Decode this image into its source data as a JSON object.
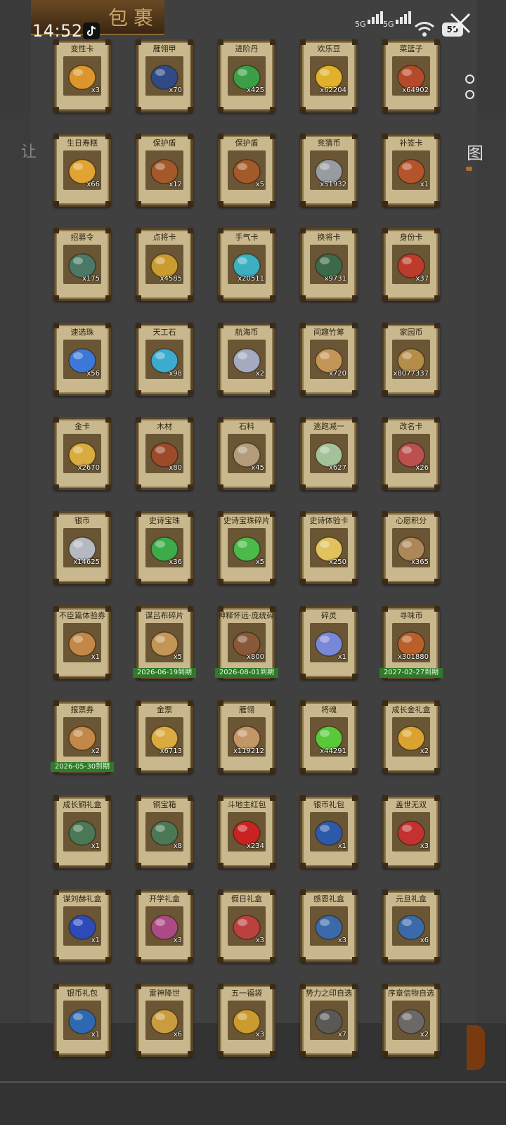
{
  "status_bar": {
    "time": "14:52",
    "net1": "5G",
    "net2": "5G",
    "battery": "55"
  },
  "header": {
    "title": "包裹"
  },
  "side": {
    "left_glyph": "让",
    "right_glyph": "图"
  },
  "items": [
    {
      "name": "变性卡",
      "count": "x3",
      "icon": "gender-card-icon",
      "color": "#e39a2c"
    },
    {
      "name": "雁翎甲",
      "count": "x70",
      "icon": "armor-icon",
      "color": "#2c4a8a"
    },
    {
      "name": "进阶丹",
      "count": "x425",
      "icon": "pill-icon",
      "color": "#3aa34a"
    },
    {
      "name": "欢乐豆",
      "count": "x62204",
      "icon": "beans-icon",
      "color": "#e8b62c"
    },
    {
      "name": "菜篮子",
      "count": "x64902",
      "icon": "basket-icon",
      "color": "#b84a2a"
    },
    {
      "name": "生日寿糕",
      "count": "x66",
      "icon": "cake-icon",
      "color": "#e8a832"
    },
    {
      "name": "保护盾",
      "count": "x12",
      "icon": "shield-icon",
      "color": "#a85a2a"
    },
    {
      "name": "保护盾",
      "count": "x5",
      "icon": "shield-icon",
      "color": "#a85a2a"
    },
    {
      "name": "竞猜币",
      "count": "x51932",
      "icon": "coin-icon",
      "color": "#9aa0a8"
    },
    {
      "name": "补签卡",
      "count": "x1",
      "icon": "sign-card-icon",
      "color": "#b8542a"
    },
    {
      "name": "招募令",
      "count": "x175",
      "icon": "recruit-icon",
      "color": "#4a7a6a"
    },
    {
      "name": "点将卡",
      "count": "x4585",
      "icon": "general-card-icon",
      "color": "#d0a030"
    },
    {
      "name": "手气卡",
      "count": "x20511",
      "icon": "luck-card-icon",
      "color": "#3ab4c8"
    },
    {
      "name": "换将卡",
      "count": "x9731",
      "icon": "swap-card-icon",
      "color": "#3a6a4a"
    },
    {
      "name": "身份卡",
      "count": "x37",
      "icon": "identity-card-icon",
      "color": "#c23a2a"
    },
    {
      "name": "速选珠",
      "count": "x56",
      "icon": "orb-icon",
      "color": "#3a7ae0"
    },
    {
      "name": "天工石",
      "count": "x98",
      "icon": "crystal-icon",
      "color": "#3ab0d8"
    },
    {
      "name": "航海币",
      "count": "x2",
      "icon": "coin-icon",
      "color": "#a8b0c8"
    },
    {
      "name": "间趣竹筹",
      "count": "x720",
      "icon": "bamboo-icon",
      "color": "#c89a5a"
    },
    {
      "name": "家园币",
      "count": "x8077337",
      "icon": "coin-icon",
      "color": "#b8904a"
    },
    {
      "name": "金卡",
      "count": "x2670",
      "icon": "gold-card-icon",
      "color": "#e0b040"
    },
    {
      "name": "木材",
      "count": "x80",
      "icon": "wood-icon",
      "color": "#a04a2a"
    },
    {
      "name": "石料",
      "count": "x45",
      "icon": "stone-icon",
      "color": "#b8a080"
    },
    {
      "name": "逃跑减一",
      "count": "x627",
      "icon": "tag-icon",
      "color": "#a8c8a0"
    },
    {
      "name": "改名卡",
      "count": "x26",
      "icon": "rename-card-icon",
      "color": "#c05050"
    },
    {
      "name": "银币",
      "count": "x14625",
      "icon": "silver-coins-icon",
      "color": "#b8c0c8"
    },
    {
      "name": "史诗宝珠",
      "count": "x36",
      "icon": "orb-icon",
      "color": "#3ab04a"
    },
    {
      "name": "史诗宝珠碎片",
      "count": "x5",
      "icon": "leaf-icon",
      "color": "#4ac04a"
    },
    {
      "name": "史诗体验卡",
      "count": "x250",
      "icon": "epic-card-icon",
      "color": "#e8c860"
    },
    {
      "name": "心愿积分",
      "count": "x365",
      "icon": "heart-coin-icon",
      "color": "#b08a5a"
    },
    {
      "name": "不臣篇体验券",
      "count": "x1",
      "icon": "ticket-icon",
      "color": "#c88a4a"
    },
    {
      "name": "谋吕布碎片",
      "count": "x5",
      "icon": "fragment-icon",
      "color": "#c89a5a",
      "expiry": "2026-06-19到期"
    },
    {
      "name": "神释怀远·庞统碎片",
      "count": "x800",
      "icon": "portrait-icon",
      "color": "#8a5a3a",
      "expiry": "2026-08-01到期"
    },
    {
      "name": "碎灵",
      "count": "x1",
      "icon": "crystal-icon",
      "color": "#7a8ae0"
    },
    {
      "name": "寻味币",
      "count": "x301880",
      "icon": "coin-icon",
      "color": "#c0602a",
      "expiry": "2027-02-27到期"
    },
    {
      "name": "报票券",
      "count": "x2",
      "icon": "ticket-icon",
      "color": "#c88a4a",
      "expiry": "2026-05-30到期"
    },
    {
      "name": "金票",
      "count": "x6713",
      "icon": "scroll-icon",
      "color": "#e0b040"
    },
    {
      "name": "雁翎",
      "count": "x119212",
      "icon": "feather-icon",
      "color": "#c89a6a"
    },
    {
      "name": "将魂",
      "count": "x44291",
      "icon": "soul-icon",
      "color": "#5ad03a"
    },
    {
      "name": "成长金礼盒",
      "count": "x2",
      "icon": "gold-chest-icon",
      "color": "#e0a830"
    },
    {
      "name": "成长铜礼盒",
      "count": "x1",
      "icon": "chest-icon",
      "color": "#4a7a5a"
    },
    {
      "name": "铜宝箱",
      "count": "x8",
      "icon": "chest-icon",
      "color": "#4a7a5a"
    },
    {
      "name": "斗地主红包",
      "count": "x234",
      "icon": "red-packet-icon",
      "color": "#d02020"
    },
    {
      "name": "银币礼包",
      "count": "x1",
      "icon": "pouch-icon",
      "color": "#2a5ab0"
    },
    {
      "name": "盖世无双",
      "count": "x3",
      "icon": "gift-box-icon",
      "color": "#c83030"
    },
    {
      "name": "谋刘赫礼盒",
      "count": "x1",
      "icon": "gift-box-icon",
      "color": "#2a4ac0"
    },
    {
      "name": "开学礼盒",
      "count": "x3",
      "icon": "gift-box-icon",
      "color": "#b04a8a"
    },
    {
      "name": "假日礼盒",
      "count": "x3",
      "icon": "gift-box-icon",
      "color": "#c04040"
    },
    {
      "name": "感恩礼盒",
      "count": "x3",
      "icon": "gift-box-icon",
      "color": "#3a6ab0"
    },
    {
      "name": "元旦礼盒",
      "count": "x6",
      "icon": "gift-box-icon",
      "color": "#3a6ab0"
    },
    {
      "name": "银币礼包",
      "count": "x1",
      "icon": "pouch-icon",
      "color": "#2a6ab8"
    },
    {
      "name": "雷神降世",
      "count": "x6",
      "icon": "gold-box-icon",
      "color": "#d0a040"
    },
    {
      "name": "五一福袋",
      "count": "x3",
      "icon": "gold-pouch-icon",
      "color": "#d0a030"
    },
    {
      "name": "势力之印自选",
      "count": "x7",
      "icon": "dark-chest-icon",
      "color": "#5a5a5a"
    },
    {
      "name": "序章信物自选",
      "count": "x2",
      "icon": "dark-chest-icon",
      "color": "#6a6a6a"
    }
  ]
}
